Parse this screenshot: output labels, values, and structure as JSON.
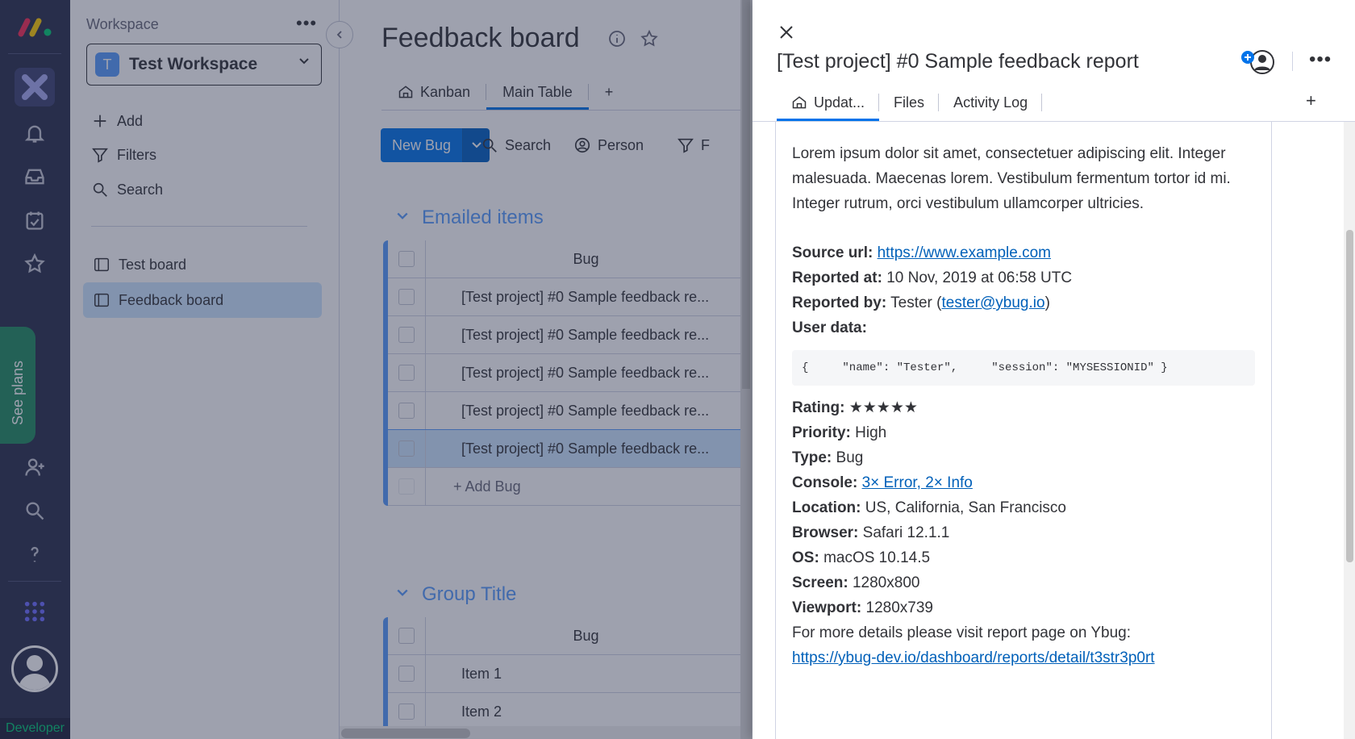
{
  "rail": {
    "developer_label": "Developer",
    "see_plans_label": "See plans",
    "icons": [
      "monday-logo",
      "apps-icon",
      "bell-icon",
      "inbox-icon",
      "my-work-icon",
      "favorites-icon",
      "invite-icon",
      "search-icon",
      "help-icon",
      "apps-grid-icon",
      "avatar-icon"
    ]
  },
  "sidebar": {
    "workspace_label": "Workspace",
    "workspace_badge": "T",
    "workspace_name": "Test Workspace",
    "actions": [
      {
        "label": "Add",
        "icon": "plus-icon"
      },
      {
        "label": "Filters",
        "icon": "filter-icon"
      },
      {
        "label": "Search",
        "icon": "search-icon"
      }
    ],
    "boards": [
      {
        "label": "Test board",
        "selected": false
      },
      {
        "label": "Feedback board",
        "selected": true
      }
    ]
  },
  "board": {
    "title": "Feedback board",
    "tabs": [
      {
        "label": "Kanban",
        "active": false
      },
      {
        "label": "Main Table",
        "active": true
      }
    ],
    "add_tab": "+",
    "new_button": "New Bug",
    "toolbar": {
      "search": "Search",
      "person": "Person",
      "filter": "F"
    },
    "groups": [
      {
        "title": "Emailed items",
        "column": "Bug",
        "rows": [
          "[Test project] #0 Sample feedback re...",
          "[Test project] #0 Sample feedback re...",
          "[Test project] #0 Sample feedback re...",
          "[Test project] #0 Sample feedback re...",
          "[Test project] #0 Sample feedback re..."
        ],
        "selected_row": 4,
        "add_label": "+ Add Bug"
      },
      {
        "title": "Group Title",
        "column": "Bug",
        "rows": [
          "Item 1",
          "Item 2"
        ]
      }
    ]
  },
  "panel": {
    "title": "[Test project] #0 Sample feedback report",
    "tabs": [
      {
        "label": "Updat...",
        "active": true
      },
      {
        "label": "Files",
        "active": false
      },
      {
        "label": "Activity Log",
        "active": false
      }
    ],
    "add_tab": "+",
    "lorem": "Lorem ipsum dolor sit amet, consectetuer adipiscing elit. Integer malesuada. Maecenas lorem. Vestibulum fermentum tortor id mi. Integer rutrum, orci vestibulum ullamcorper ultricies.",
    "source_url_label": "Source url:",
    "source_url": "https://www.example.com",
    "reported_at_label": "Reported at:",
    "reported_at": "10 Nov, 2019 at 06:58 UTC",
    "reported_by_label": "Reported by:",
    "reported_by_name": "Tester (",
    "reported_by_email": "tester@ybug.io",
    "reported_by_close": ")",
    "user_data_label": "User data:",
    "user_data_code": "{     \"name\": \"Tester\",     \"session\": \"MYSESSIONID\" }",
    "rating_label": "Rating:",
    "rating_value": "★★★★★",
    "priority_label": "Priority:",
    "priority": "High",
    "type_label": "Type:",
    "type": "Bug",
    "console_label": "Console:",
    "console": "3× Error, 2× Info",
    "location_label": "Location:",
    "location": "US, California, San Francisco",
    "browser_label": "Browser:",
    "browser": "Safari 12.1.1",
    "os_label": "OS:",
    "os": "macOS 10.14.5",
    "screen_label": "Screen:",
    "screen": "1280x800",
    "viewport_label": "Viewport:",
    "viewport": "1280x739",
    "more_details": "For more details please visit report page on Ybug:",
    "report_link": "https://ybug-dev.io/dashboard/reports/detail/t3str3p0rt"
  }
}
